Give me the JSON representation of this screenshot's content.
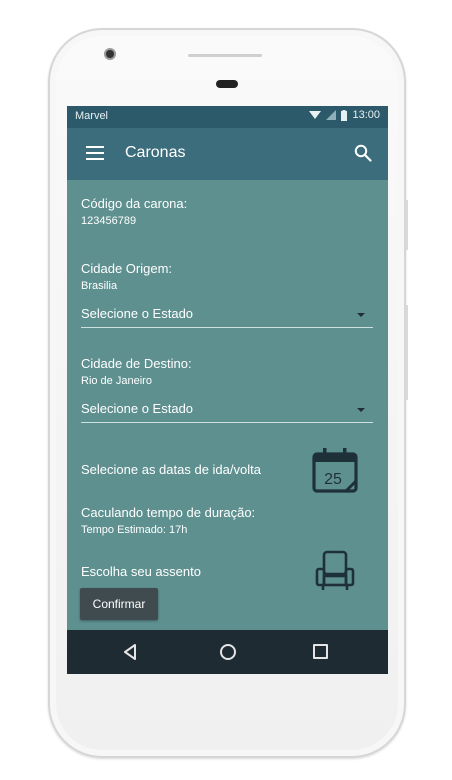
{
  "status_bar": {
    "carrier": "Marvel",
    "time": "13:00"
  },
  "app_bar": {
    "title": "Caronas",
    "menu_icon": "menu-icon",
    "search_icon": "search-icon"
  },
  "form": {
    "code_label": "Código da carona:",
    "code_value": "123456789",
    "origin_label": "Cidade Origem:",
    "origin_value": "Brasilia",
    "origin_state_select": "Selecione o Estado",
    "dest_label": "Cidade de Destino:",
    "dest_value": "Rio de Janeiro",
    "dest_state_select": "Selecione o Estado",
    "dates_label": "Selecione as datas de ida/volta",
    "calendar_day": "25",
    "duration_label": "Caculando tempo de duração:",
    "duration_value": "Tempo Estimado: 17h",
    "seat_label": "Escolha seu assento",
    "confirm_label": "Confirmar"
  },
  "colors": {
    "content_bg": "#5e9090",
    "app_bar": "#3c6d7c",
    "status_bar": "#2d5a6b",
    "nav_bar": "#1f2b33",
    "button": "#404b50"
  },
  "nav_bar": {
    "items": [
      "back-icon",
      "home-icon",
      "recents-icon"
    ]
  }
}
